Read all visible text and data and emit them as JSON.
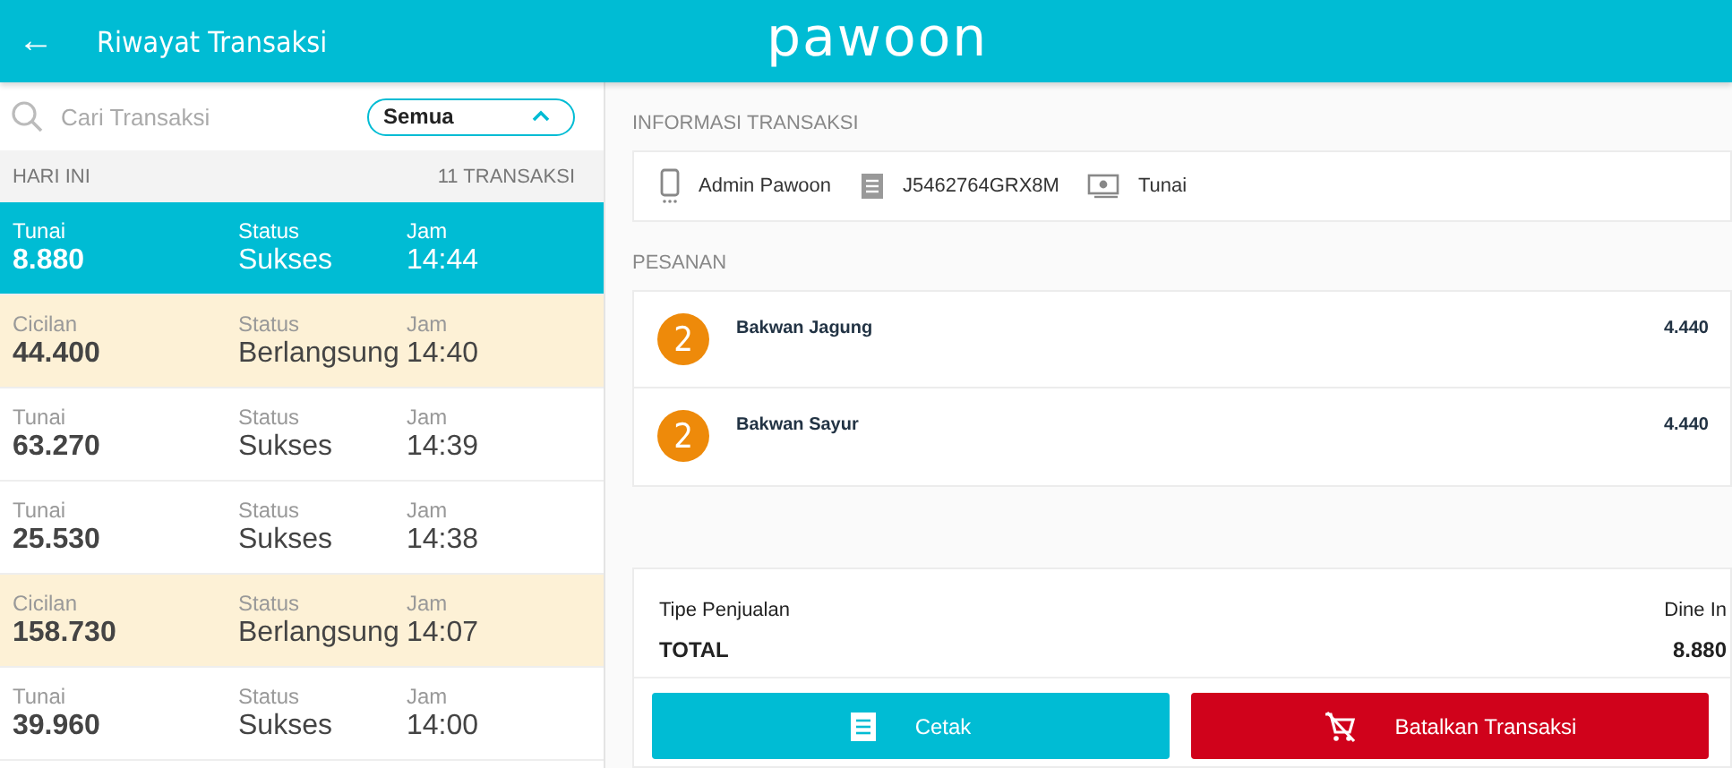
{
  "header": {
    "back": "←",
    "title": "Riwayat Transaksi",
    "logo": "pawoon"
  },
  "search": {
    "placeholder": "Cari Transaksi"
  },
  "filter": {
    "value": "Semua",
    "expanded": true
  },
  "list_header": {
    "label": "HARI INI",
    "count": "11 TRANSAKSI"
  },
  "transactions": [
    {
      "method": "Tunai",
      "amount": "8.880",
      "status_label": "Status",
      "status": "Sukses",
      "time_label": "Jam",
      "time": "14:44",
      "selected": true,
      "pending": false
    },
    {
      "method": "Cicilan",
      "amount": "44.400",
      "status_label": "Status",
      "status": "Berlangsung",
      "time_label": "Jam",
      "time": "14:40",
      "selected": false,
      "pending": true
    },
    {
      "method": "Tunai",
      "amount": "63.270",
      "status_label": "Status",
      "status": "Sukses",
      "time_label": "Jam",
      "time": "14:39",
      "selected": false,
      "pending": false
    },
    {
      "method": "Tunai",
      "amount": "25.530",
      "status_label": "Status",
      "status": "Sukses",
      "time_label": "Jam",
      "time": "14:38",
      "selected": false,
      "pending": false
    },
    {
      "method": "Cicilan",
      "amount": "158.730",
      "status_label": "Status",
      "status": "Berlangsung",
      "time_label": "Jam",
      "time": "14:07",
      "selected": false,
      "pending": true
    },
    {
      "method": "Tunai",
      "amount": "39.960",
      "status_label": "Status",
      "status": "Sukses",
      "time_label": "Jam",
      "time": "14:00",
      "selected": false,
      "pending": false
    }
  ],
  "info": {
    "heading": "INFORMASI TRANSAKSI",
    "items": [
      {
        "kind": "device",
        "text": "Admin Pawoon"
      },
      {
        "kind": "receipt",
        "text": "J5462764GRX8M"
      },
      {
        "kind": "cash",
        "text": "Tunai"
      }
    ]
  },
  "orders": {
    "heading": "PESANAN",
    "items": [
      {
        "qty": "2",
        "name": "Bakwan Jagung",
        "price": "4.440"
      },
      {
        "qty": "2",
        "name": "Bakwan Sayur",
        "price": "4.440"
      }
    ]
  },
  "summary": [
    {
      "label": "Tipe Penjualan",
      "value": "Dine In",
      "bold": false
    },
    {
      "label": "TOTAL",
      "value": "8.880",
      "bold": true
    }
  ],
  "actions": [
    {
      "kind": "print",
      "label": "Cetak"
    },
    {
      "kind": "cancel",
      "label": "Batalkan Transaksi"
    }
  ]
}
